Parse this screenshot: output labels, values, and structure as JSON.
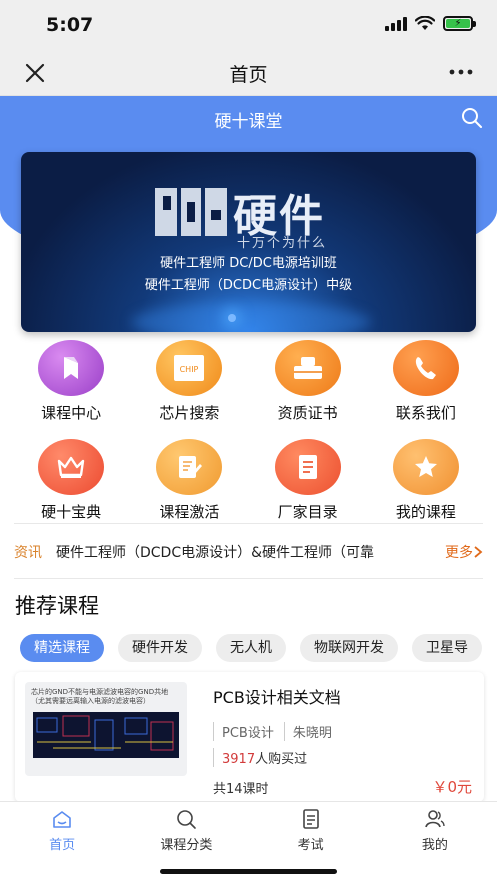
{
  "status_bar": {
    "time": "5:07",
    "battery_label": "⚡"
  },
  "nav": {
    "title": "首页"
  },
  "header": {
    "title": "硬十课堂"
  },
  "banner": {
    "brand_big": "硬件",
    "brand_sub": "十万个为什么",
    "line1": "硬件工程师 DC/DC电源培训班",
    "line2": "硬件工程师（DCDC电源设计）中级"
  },
  "grid": [
    {
      "label": "课程中心",
      "icon": "bookmark-icon",
      "color": "#b05bd6"
    },
    {
      "label": "芯片搜索",
      "icon": "chip-icon",
      "color": "#f0a030",
      "icon_text": "CHIP"
    },
    {
      "label": "资质证书",
      "icon": "certificate-icon",
      "color": "#f08a2a"
    },
    {
      "label": "联系我们",
      "icon": "phone-icon",
      "color": "#f07a2a"
    },
    {
      "label": "硬十宝典",
      "icon": "crown-icon",
      "color": "#f05a40"
    },
    {
      "label": "课程激活",
      "icon": "edit-note-icon",
      "color": "#f0a040"
    },
    {
      "label": "厂家目录",
      "icon": "document-list-icon",
      "color": "#f06040"
    },
    {
      "label": "我的课程",
      "icon": "star-icon",
      "color": "#f0a040"
    }
  ],
  "news": {
    "tag": "资讯",
    "text": "硬件工程师（DCDC电源设计）&硬件工程师（可靠",
    "more": "更多"
  },
  "recommend": {
    "title": "推荐课程"
  },
  "chips": [
    "精选课程",
    "硬件开发",
    "无人机",
    "物联网开发",
    "卫星导"
  ],
  "course": {
    "thumb_caption": "芯片的GND不能与电源滤波电容的GND共地（尤其需要远离输入电源的滤波电容）",
    "title": "PCB设计相关文档",
    "category": "PCB设计",
    "author": "朱晓明",
    "buy_count": "3917",
    "buy_suffix": "人购买过",
    "lessons": "共14课时",
    "price": "￥0元"
  },
  "tabs": [
    {
      "label": "首页",
      "icon": "home-icon",
      "active": true
    },
    {
      "label": "课程分类",
      "icon": "search-icon"
    },
    {
      "label": "考试",
      "icon": "exam-icon"
    },
    {
      "label": "我的",
      "icon": "user-icon"
    }
  ],
  "colors": {
    "accent": "#5a8cf0",
    "price": "#e0483b",
    "news_tag": "#d9822b"
  }
}
